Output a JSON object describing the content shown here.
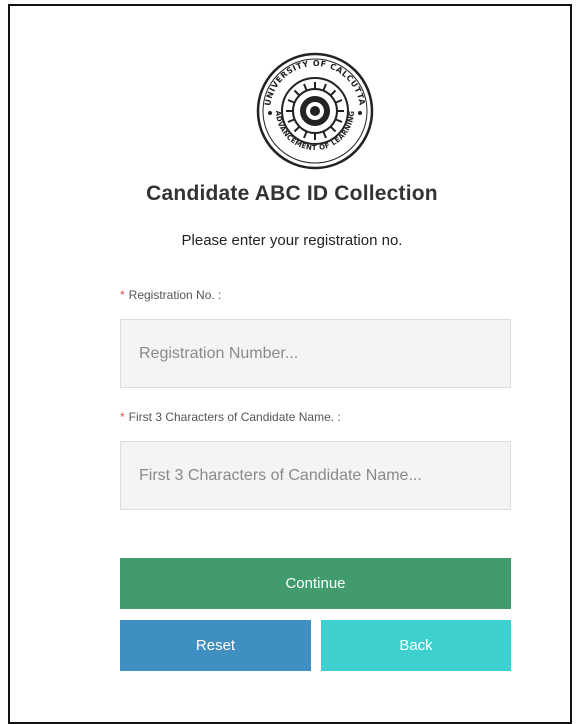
{
  "logo": {
    "ring_text_top": "UNIVERSITY OF CALCUTTA",
    "ring_text_bottom": "ADVANCEMENT OF LEARNING",
    "icon": "university-seal-icon"
  },
  "header": {
    "title": "Candidate ABC ID Collection",
    "subtitle": "Please enter your registration no."
  },
  "form": {
    "registration": {
      "required_mark": "*",
      "label": "Registration No. :",
      "value": "",
      "placeholder": "Registration Number..."
    },
    "name_prefix": {
      "required_mark": "*",
      "label": "First 3 Characters of Candidate Name. :",
      "value": "",
      "placeholder": "First 3 Characters of Candidate Name..."
    }
  },
  "buttons": {
    "continue_label": "Continue",
    "reset_label": "Reset",
    "back_label": "Back"
  },
  "colors": {
    "continue": "#419b6d",
    "reset": "#3f8fc2",
    "back": "#3ecfcf",
    "required": "#d9534f"
  }
}
